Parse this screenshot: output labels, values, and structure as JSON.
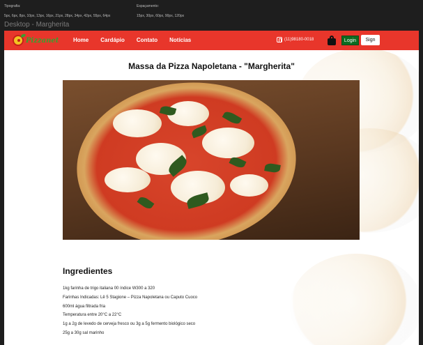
{
  "specs": {
    "typography_label": "Tipografia:",
    "typography_values": "5px, 6px, 8px, 10px, 13px, 16px, 21px, 28px, 34px, 42px, 55px, 64px",
    "spacing_label": "Espaçamento:",
    "spacing_values": "15px, 30px, 60px, 90px, 120px"
  },
  "frame_title": "Desktop - Margherita",
  "header": {
    "logo_text": "Pizzanet",
    "nav": [
      "Home",
      "Cardápio",
      "Contato",
      "Notícias"
    ],
    "phone": "(11)98180-0018",
    "login_label": "Login",
    "sign_label": "Sign",
    "colors": {
      "header_bg": "#e8362b",
      "login_bg": "#0d6b20",
      "logo_green": "#3aa02e"
    },
    "icons": [
      "whatsapp-icon",
      "shopping-bag-icon"
    ]
  },
  "page": {
    "title": "Massa da Pizza Napoletana - \"Margherita\"",
    "ingredients_title": "Ingredientes",
    "ingredients": [
      "1kg farinha de trigo italiana 00 índice W300 a 320",
      "Farinhas Indicadas: Lê 5 Stagione – Pizza Napoletana ou Caputo Cuoco",
      "600ml água filtrada fria",
      "Temperatura entre 20°C a 22°C",
      "1g a 2g de levedo de cerveja fresco ou 3g a 5g fermento biológico seco",
      "25g a 30g sal marinho"
    ]
  }
}
